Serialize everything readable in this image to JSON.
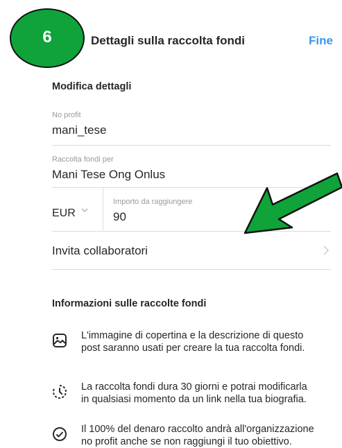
{
  "header": {
    "step_number": "6",
    "title": "Dettagli sulla raccolta fondi",
    "done_label": "Fine"
  },
  "details": {
    "section_title": "Modifica dettagli",
    "nonprofit_label": "No profit",
    "nonprofit_value": "mani_tese",
    "fundraiser_for_label": "Raccolta fondi per",
    "fundraiser_for_value": "Mani Tese Ong Onlus",
    "currency": "EUR",
    "goal_label": "Importo da raggiungere",
    "goal_value": "90",
    "invite_label": "Invita collaboratori"
  },
  "info": {
    "section_title": "Informazioni sulle raccolte fondi",
    "items": [
      {
        "icon": "image-icon",
        "line1": "L'immagine di copertina e la descrizione di questo",
        "line2": "post saranno usati per creare la tua raccolta fondi."
      },
      {
        "icon": "clock-icon",
        "line1": "La raccolta fondi dura 30 giorni e potrai modificarla",
        "line2": "in qualsiasi momento da un link nella tua biografia."
      },
      {
        "icon": "check-circle-icon",
        "line1": "Il 100% del denaro raccolto andrà all'organizzazione",
        "line2": "no profit anche se non raggiungi il tuo obiettivo."
      }
    ]
  },
  "colors": {
    "accent": "#3897f0",
    "annotation_green": "#0fa33a",
    "text": "#262626",
    "label": "#9a9a9a",
    "divider": "#dbdbdb"
  }
}
